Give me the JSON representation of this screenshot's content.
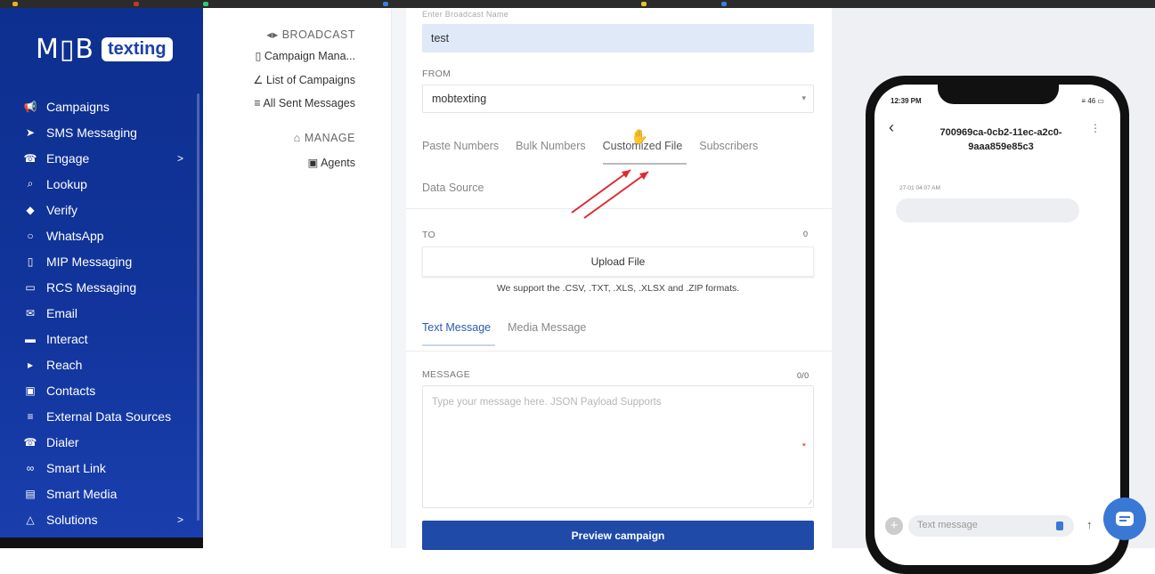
{
  "sidebar": {
    "logo_mob": "M▯B",
    "logo_text": "texting",
    "items": [
      {
        "label": "Campaigns",
        "icon": "megaphone-icon",
        "glyph": "📢"
      },
      {
        "label": "SMS Messaging",
        "icon": "send-icon",
        "glyph": "➤"
      },
      {
        "label": "Engage",
        "icon": "phone-icon",
        "glyph": "☎",
        "chevron": ">"
      },
      {
        "label": "Lookup",
        "icon": "search-icon",
        "glyph": "⌕"
      },
      {
        "label": "Verify",
        "icon": "shield-icon",
        "glyph": "◆"
      },
      {
        "label": "WhatsApp",
        "icon": "whatsapp-icon",
        "glyph": "○"
      },
      {
        "label": "MIP Messaging",
        "icon": "mobile-icon",
        "glyph": "▯"
      },
      {
        "label": "RCS Messaging",
        "icon": "chat-icon",
        "glyph": "▭"
      },
      {
        "label": "Email",
        "icon": "mail-icon",
        "glyph": "✉"
      },
      {
        "label": "Interact",
        "icon": "gamepad-icon",
        "glyph": "▬"
      },
      {
        "label": "Reach",
        "icon": "bullhorn-icon",
        "glyph": "▸"
      },
      {
        "label": "Contacts",
        "icon": "contacts-icon",
        "glyph": "▣"
      },
      {
        "label": "External Data Sources",
        "icon": "database-icon",
        "glyph": "≡"
      },
      {
        "label": "Dialer",
        "icon": "dialer-icon",
        "glyph": "☎"
      },
      {
        "label": "Smart Link",
        "icon": "link-icon",
        "glyph": "∞"
      },
      {
        "label": "Smart Media",
        "icon": "media-icon",
        "glyph": "▤"
      },
      {
        "label": "Solutions",
        "icon": "triangle-icon",
        "glyph": "△",
        "chevron": ">"
      }
    ]
  },
  "submenu": {
    "broadcast": "◂▸ BROADCAST",
    "campaign_manager": "▯ Campaign Mana...",
    "list_of_campaigns": "∠ List of Campaigns",
    "all_sent_messages": "≡ All Sent Messages",
    "manage": "⌂ MANAGE",
    "agents": "▣ Agents"
  },
  "form": {
    "name_label_cut": "Enter Broadcast Name",
    "name_value": "test",
    "from_label": "FROM",
    "from_value": "mobtexting",
    "recipient_tabs": [
      "Paste Numbers",
      "Bulk Numbers",
      "Customized File",
      "Subscribers"
    ],
    "data_source_tab": "Data Source",
    "to_label": "TO",
    "to_count": "0",
    "upload_button": "Upload File",
    "formats_note": "We support the .CSV, .TXT, .XLS, .XLSX and .ZIP formats.",
    "message_tabs": [
      "Text Message",
      "Media Message"
    ],
    "message_label": "MESSAGE",
    "message_counter": "0/0",
    "message_placeholder": "Type your message here. JSON Payload Supports",
    "required_mark": "*",
    "preview_button": "Preview campaign"
  },
  "phone": {
    "time": "12:39 PM",
    "status": "≡ 46 ▭",
    "contact": "700969ca-0cb2-11ec-a2c0-9aaa859e85c3",
    "timestamp": "27-01 04:07 AM",
    "input_placeholder": "Text message"
  },
  "colors": {
    "sidebar": "#12359d",
    "accent": "#1f4aa8",
    "input_bg": "#dfe9f7",
    "arrow": "#e0282e"
  }
}
